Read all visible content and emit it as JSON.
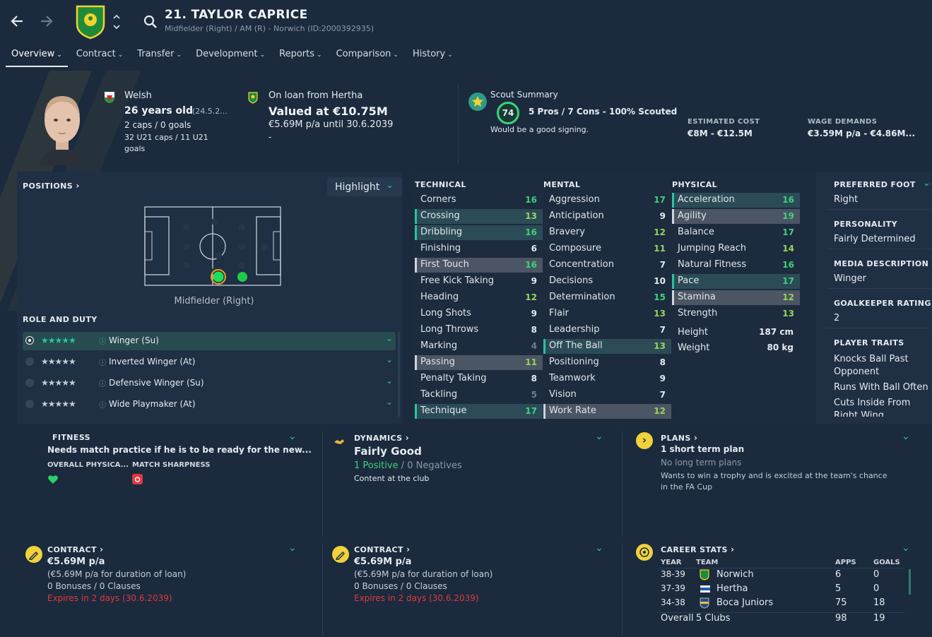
{
  "header": {
    "player_title": "21. TAYLOR CAPRICE",
    "subtitle": "Midfielder (Right) / AM (R) - Norwich (ID:2000392935)",
    "tabs": [
      {
        "label": "Overview"
      },
      {
        "label": "Contract"
      },
      {
        "label": "Transfer"
      },
      {
        "label": "Development"
      },
      {
        "label": "Reports"
      },
      {
        "label": "Comparison"
      },
      {
        "label": "History"
      }
    ]
  },
  "bio": {
    "nationality": "Welsh",
    "age": "26 years old",
    "dob": "(24.5.2...",
    "caps": "2 caps / 0 goals",
    "u21_caps": "32 U21 caps / 11 U21",
    "u21_goals": "goals"
  },
  "loan": {
    "status": "On loan from Hertha",
    "value": "Valued at €10.75M",
    "wage": "€5.69M p/a until 30.6.2039",
    "extra": "-"
  },
  "scout": {
    "title": "Scout Summary",
    "rating": "74",
    "summary": "5 Pros / 7 Cons - 100% Scouted",
    "verdict": "Would be a good signing.",
    "est_cost_label": "ESTIMATED COST",
    "est_cost": "€8M - €12.5M",
    "wage_demands_label": "WAGE DEMANDS",
    "wage_demands": "€3.59M p/a - €4.86M..."
  },
  "positions": {
    "title": "POSITIONS",
    "highlight_btn": "Highlight",
    "position_name": "Midfielder (Right)",
    "role_title": "ROLE AND DUTY",
    "roles": [
      {
        "stars": "★★★★★",
        "name": "Winger (Su)",
        "selected": true
      },
      {
        "stars": "★★★★★",
        "name": "Inverted Winger (At)",
        "selected": false
      },
      {
        "stars": "★★★★★",
        "name": "Defensive Winger (Su)",
        "selected": false
      },
      {
        "stars": "★★★★★",
        "name": "Wide Playmaker (At)",
        "selected": false
      }
    ]
  },
  "attributes": {
    "technical_title": "TECHNICAL",
    "mental_title": "MENTAL",
    "physical_title": "PHYSICAL",
    "technical": [
      {
        "name": "Corners",
        "value": "16",
        "hl": ""
      },
      {
        "name": "Crossing",
        "value": "13",
        "hl": "hl"
      },
      {
        "name": "Dribbling",
        "value": "16",
        "hl": "hl"
      },
      {
        "name": "Finishing",
        "value": "6",
        "hl": ""
      },
      {
        "name": "First Touch",
        "value": "16",
        "hl": "gl"
      },
      {
        "name": "Free Kick Taking",
        "value": "9",
        "hl": ""
      },
      {
        "name": "Heading",
        "value": "12",
        "hl": ""
      },
      {
        "name": "Long Shots",
        "value": "9",
        "hl": ""
      },
      {
        "name": "Long Throws",
        "value": "8",
        "hl": ""
      },
      {
        "name": "Marking",
        "value": "4",
        "hl": ""
      },
      {
        "name": "Passing",
        "value": "11",
        "hl": "gl"
      },
      {
        "name": "Penalty Taking",
        "value": "8",
        "hl": ""
      },
      {
        "name": "Tackling",
        "value": "5",
        "hl": ""
      },
      {
        "name": "Technique",
        "value": "17",
        "hl": "hl"
      }
    ],
    "mental": [
      {
        "name": "Aggression",
        "value": "17",
        "hl": ""
      },
      {
        "name": "Anticipation",
        "value": "9",
        "hl": ""
      },
      {
        "name": "Bravery",
        "value": "12",
        "hl": ""
      },
      {
        "name": "Composure",
        "value": "11",
        "hl": ""
      },
      {
        "name": "Concentration",
        "value": "7",
        "hl": ""
      },
      {
        "name": "Decisions",
        "value": "10",
        "hl": ""
      },
      {
        "name": "Determination",
        "value": "15",
        "hl": ""
      },
      {
        "name": "Flair",
        "value": "13",
        "hl": ""
      },
      {
        "name": "Leadership",
        "value": "7",
        "hl": ""
      },
      {
        "name": "Off The Ball",
        "value": "13",
        "hl": "hl"
      },
      {
        "name": "Positioning",
        "value": "8",
        "hl": ""
      },
      {
        "name": "Teamwork",
        "value": "9",
        "hl": ""
      },
      {
        "name": "Vision",
        "value": "7",
        "hl": ""
      },
      {
        "name": "Work Rate",
        "value": "12",
        "hl": "gl"
      }
    ],
    "physical": [
      {
        "name": "Acceleration",
        "value": "16",
        "hl": "hl"
      },
      {
        "name": "Agility",
        "value": "19",
        "hl": "gl"
      },
      {
        "name": "Balance",
        "value": "17",
        "hl": ""
      },
      {
        "name": "Jumping Reach",
        "value": "14",
        "hl": ""
      },
      {
        "name": "Natural Fitness",
        "value": "16",
        "hl": ""
      },
      {
        "name": "Pace",
        "value": "17",
        "hl": "hl"
      },
      {
        "name": "Stamina",
        "value": "12",
        "hl": "gl"
      },
      {
        "name": "Strength",
        "value": "13",
        "hl": ""
      }
    ],
    "height_label": "Height",
    "height": "187 cm",
    "weight_label": "Weight",
    "weight": "80 kg"
  },
  "side": {
    "foot_label": "PREFERRED FOOT",
    "foot": "Right",
    "personality_label": "PERSONALITY",
    "personality": "Fairly Determined",
    "media_label": "MEDIA DESCRIPTION",
    "media": "Winger",
    "gk_label": "GOALKEEPER RATING",
    "gk": "2",
    "traits_label": "PLAYER TRAITS",
    "traits": [
      "Knocks Ball Past",
      "Opponent",
      "Runs With Ball Often",
      "Cuts Inside From",
      "Right Wing"
    ]
  },
  "fitness": {
    "title": "FITNESS",
    "headline": "Needs match practice if he is to be ready for the new...",
    "overall_label": "OVERALL PHYSICA...",
    "sharpness_label": "MATCH SHARPNESS"
  },
  "dynamics": {
    "title": "DYNAMICS",
    "headline": "Fairly Good",
    "positives": "1 Positive",
    "sep": "/",
    "negatives": "0 Negatives",
    "content": "Content at the club"
  },
  "plans": {
    "title": "PLANS",
    "short": "1 short term plan",
    "long": "No long term plans",
    "desc1": "Wants to win a trophy and is excited at the team's chance",
    "desc2": "in the FA Cup"
  },
  "contract1": {
    "title": "CONTRACT",
    "wage": "€5.69M p/a",
    "note": "(€5.69M p/a for duration of loan)",
    "bonuses": "0 Bonuses / 0 Clauses",
    "expires": "Expires in 2 days (30.6.2039)"
  },
  "contract2": {
    "title": "CONTRACT",
    "wage": "€5.69M p/a",
    "note": "(€5.69M p/a for duration of loan)",
    "bonuses": "0 Bonuses / 0 Clauses",
    "expires": "Expires in 2 days (30.6.2039)"
  },
  "career": {
    "title": "CAREER STATS",
    "col_year": "YEAR",
    "col_team": "TEAM",
    "col_apps": "APPS",
    "col_goals": "GOALS",
    "rows": [
      {
        "year": "38-39",
        "team": "Norwich",
        "apps": "6",
        "goals": "0"
      },
      {
        "year": "37-39",
        "team": "Hertha",
        "apps": "5",
        "goals": "0"
      },
      {
        "year": "34-38",
        "team": "Boca Juniors",
        "apps": "75",
        "goals": "18"
      }
    ],
    "overall_label": "Overall",
    "overall_clubs": "5 Clubs",
    "overall_apps": "98",
    "overall_goals": "19"
  },
  "colors": {
    "bg": "#1b2a3d",
    "highlight": "#2ac3a2",
    "green_value": "#3ed27c",
    "red": "#e0383e",
    "yellow": "#f0d23a"
  }
}
